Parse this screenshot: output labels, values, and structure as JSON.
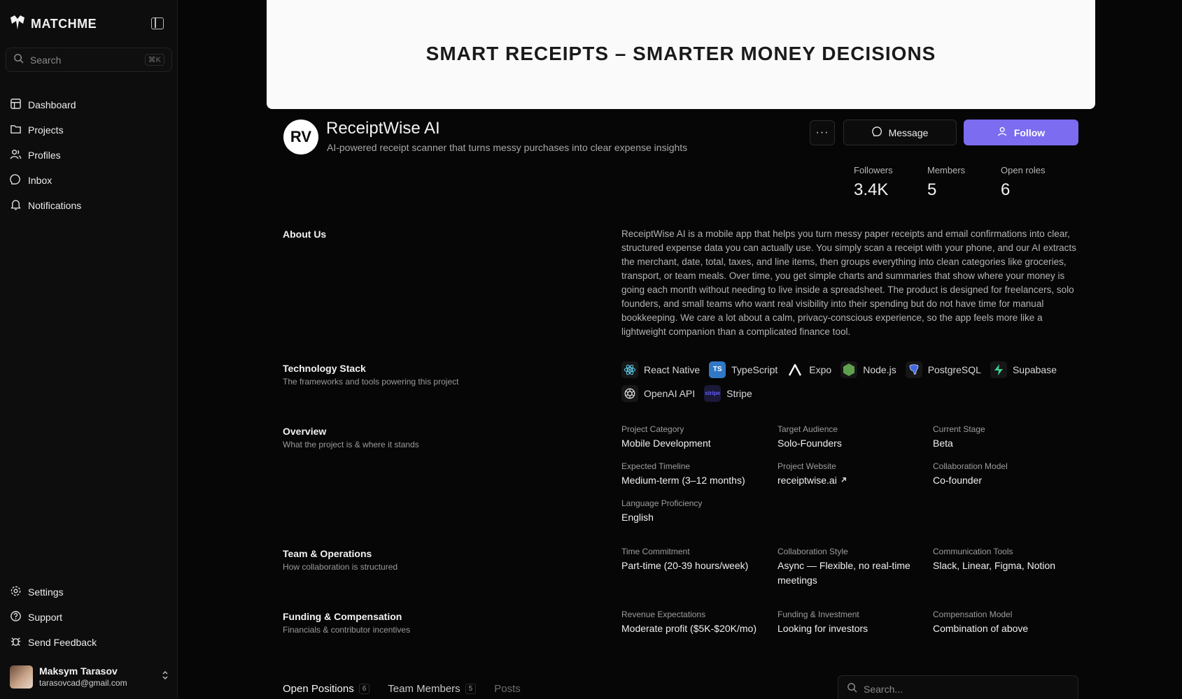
{
  "sidebar": {
    "brand": "MATCHME",
    "search": {
      "placeholder": "Search",
      "shortcut": "⌘K"
    },
    "nav": [
      "Dashboard",
      "Projects",
      "Profiles",
      "Inbox",
      "Notifications"
    ],
    "bottom_nav": [
      "Settings",
      "Support",
      "Send Feedback"
    ],
    "user": {
      "name": "Maksym Tarasov",
      "email": "tarasovcad@gmail.com"
    }
  },
  "banner": {
    "title": "SMART RECEIPTS – SMARTER MONEY DECISIONS"
  },
  "project": {
    "logo_text": "RV",
    "name": "ReceiptWise AI",
    "tagline": "AI-powered receipt scanner that turns messy purchases into clear expense insights"
  },
  "actions": {
    "more": "···",
    "message": "Message",
    "follow": "Follow"
  },
  "stats": [
    {
      "label": "Followers",
      "value": "3.4K"
    },
    {
      "label": "Members",
      "value": "5"
    },
    {
      "label": "Open roles",
      "value": "6"
    }
  ],
  "about": {
    "title": "About Us",
    "text": "ReceiptWise AI is a mobile app that helps you turn messy paper receipts and email confirmations into clear, structured expense data you can actually use. You simply scan a receipt with your phone, and our AI extracts the merchant, date, total, taxes, and line items, then groups everything into clean categories like groceries, transport, or team meals. Over time, you get simple charts and summaries that show where your money is going each month without needing to live inside a spreadsheet. The product is designed for freelancers, solo founders, and small teams who want real visibility into their spending but do not have time for manual bookkeeping. We care a lot about a calm, privacy-conscious experience, so the app feels more like a lightweight companion than a complicated finance tool."
  },
  "tech": {
    "title": "Technology Stack",
    "subtitle": "The frameworks and tools powering this project",
    "items": [
      {
        "name": "React Native",
        "icon": "react-icon",
        "color": "#61dafb"
      },
      {
        "name": "TypeScript",
        "icon": "typescript-icon",
        "color": "#3178c6"
      },
      {
        "name": "Expo",
        "icon": "expo-icon",
        "color": "#ffffff"
      },
      {
        "name": "Node.js",
        "icon": "nodejs-icon",
        "color": "#5fa04e"
      },
      {
        "name": "PostgreSQL",
        "icon": "postgresql-icon",
        "color": "#4169e1"
      },
      {
        "name": "Supabase",
        "icon": "supabase-icon",
        "color": "#3ecf8e"
      },
      {
        "name": "OpenAI API",
        "icon": "openai-icon",
        "color": "#e6e6e6"
      },
      {
        "name": "Stripe",
        "icon": "stripe-icon",
        "color": "#635bff"
      }
    ]
  },
  "overview": {
    "title": "Overview",
    "subtitle": "What the project is & where it stands",
    "fields": [
      {
        "label": "Project Category",
        "value": "Mobile Development"
      },
      {
        "label": "Target Audience",
        "value": "Solo-Founders"
      },
      {
        "label": "Current Stage",
        "value": "Beta"
      },
      {
        "label": "Expected Timeline",
        "value": "Medium-term (3–12 months)"
      },
      {
        "label": "Project Website",
        "value": "receiptwise.ai"
      },
      {
        "label": "Collaboration Model",
        "value": "Co-founder"
      },
      {
        "label": "Language Proficiency",
        "value": "English"
      }
    ]
  },
  "team": {
    "title": "Team & Operations",
    "subtitle": "How collaboration is structured",
    "fields": [
      {
        "label": "Time Commitment",
        "value": "Part-time (20-39 hours/week)"
      },
      {
        "label": "Collaboration Style",
        "value": "Async — Flexible, no real-time meetings"
      },
      {
        "label": "Communication Tools",
        "value": "Slack, Linear, Figma, Notion"
      }
    ]
  },
  "funding": {
    "title": "Funding & Compensation",
    "subtitle": "Financials & contributor incentives",
    "fields": [
      {
        "label": "Revenue Expectations",
        "value": "Moderate profit ($5K-$20K/mo)"
      },
      {
        "label": "Funding & Investment",
        "value": "Looking for investors"
      },
      {
        "label": "Compensation Model",
        "value": "Combination of above"
      }
    ]
  },
  "tabs": [
    {
      "label": "Open Positions",
      "count": "6"
    },
    {
      "label": "Team Members",
      "count": "5"
    },
    {
      "label": "Posts"
    }
  ],
  "positions_search": {
    "placeholder": "Search..."
  },
  "colors": {
    "accent": "#7b6cf0",
    "background": "#060606",
    "sidebar": "#0d0d0d"
  }
}
